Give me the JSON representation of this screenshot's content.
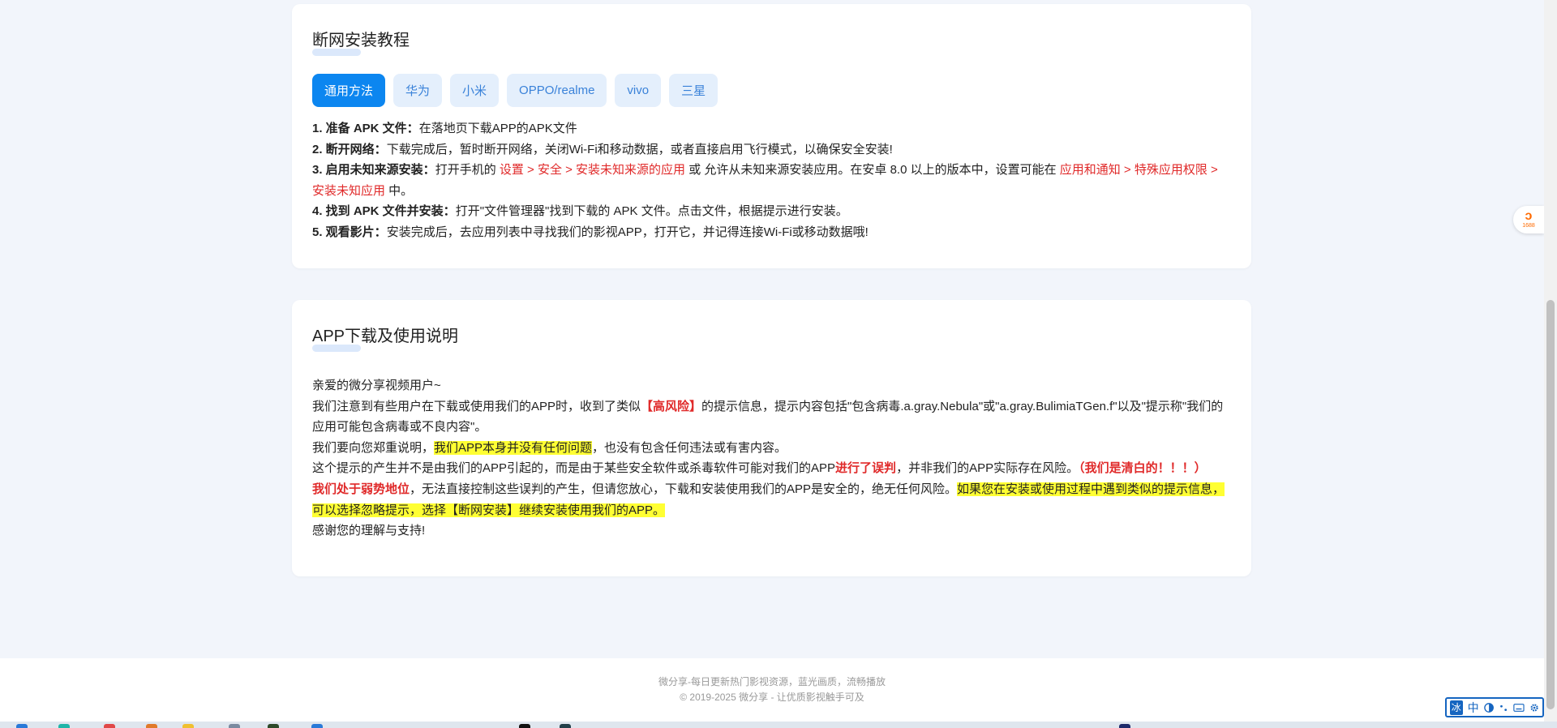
{
  "section1": {
    "title": "断网安装教程",
    "tabs": [
      {
        "label": "通用方法",
        "active": true
      },
      {
        "label": "华为",
        "active": false
      },
      {
        "label": "小米",
        "active": false
      },
      {
        "label": "OPPO/realme",
        "active": false
      },
      {
        "label": "vivo",
        "active": false
      },
      {
        "label": "三星",
        "active": false
      }
    ],
    "steps": {
      "s1_bold": "1. 准备 APK 文件：",
      "s1_text": "在落地页下载APP的APK文件",
      "s2_bold": "2. 断开网络：",
      "s2_text": "下载完成后，暂时断开网络，关闭Wi-Fi和移动数据，或者直接启用飞行模式，以确保安全安装!",
      "s3_bold": "3. 启用未知来源安装：",
      "s3_text1": "打开手机的 ",
      "s3_path1": "设置 > 安全 > 安装未知来源的应用",
      "s3_text2": " 或 允许从未知来源安装应用。在安卓 8.0 以上的版本中，设置可能在 ",
      "s3_path2": "应用和通知 > 特殊应用权限 > 安装未知应用",
      "s3_text3": " 中。",
      "s4_bold": "4. 找到 APK 文件并安装：",
      "s4_text": "打开\"文件管理器\"找到下载的 APK 文件。点击文件，根据提示进行安装。",
      "s5_bold": "5. 观看影片：",
      "s5_text": "安装完成后，去应用列表中寻找我们的影视APP，打开它，并记得连接Wi-Fi或移动数据哦!"
    }
  },
  "section2": {
    "title": "APP下载及使用说明",
    "greeting": "亲爱的微分享视频用户~",
    "p1_a": "我们注意到有些用户在下载或使用我们的APP时，收到了类似",
    "p1_risk": "【高风险】",
    "p1_b": "的提示信息，提示内容包括\"包含病毒.a.gray.Nebula\"或\"a.gray.BulimiaTGen.f\"以及\"提示称\"我们的应用可能包含病毒或不良内容\"。",
    "p2_a": "我们要向您郑重说明，",
    "p2_hl": "我们APP本身并没有任何问题",
    "p2_b": "，也没有包含任何违法或有害内容。",
    "p3_a": "这个提示的产生并不是由我们的APP引起的，而是由于某些安全软件或杀毒软件可能对我们的APP",
    "p3_red": "进行了误判",
    "p3_b": "，并非我们的APP实际存在风险。",
    "p3_red2": "（我们是清白的！！！）",
    "p4_red": "我们处于弱势地位",
    "p4_a": "，无法直接控制这些误判的产生，但请您放心，下载和安装使用我们的APP是安全的，绝无任何风险。",
    "p4_hl": "如果您在安装或使用过程中遇到类似的提示信息，可以选择忽略提示，选择【断网安装】继续安装使用我们的APP。",
    "thanks": "感谢您的理解与支持!"
  },
  "footer": {
    "line1": "微分享-每日更新热门影视资源，蓝光画质，流畅播放",
    "line2": "© 2019-2025 微分享 - 让优质影视触手可及"
  },
  "side_badge": {
    "glyph": "ↄ",
    "num": "1688",
    "icon": "alibaba-1688-icon"
  },
  "ime": {
    "logo": "冰",
    "mode": "中",
    "icon": "ime-toolbar"
  },
  "colors": {
    "accent": "#0c86f0",
    "tab_bg": "#e4effc",
    "warning_red": "#e02a2a",
    "highlight": "#ffff33"
  }
}
